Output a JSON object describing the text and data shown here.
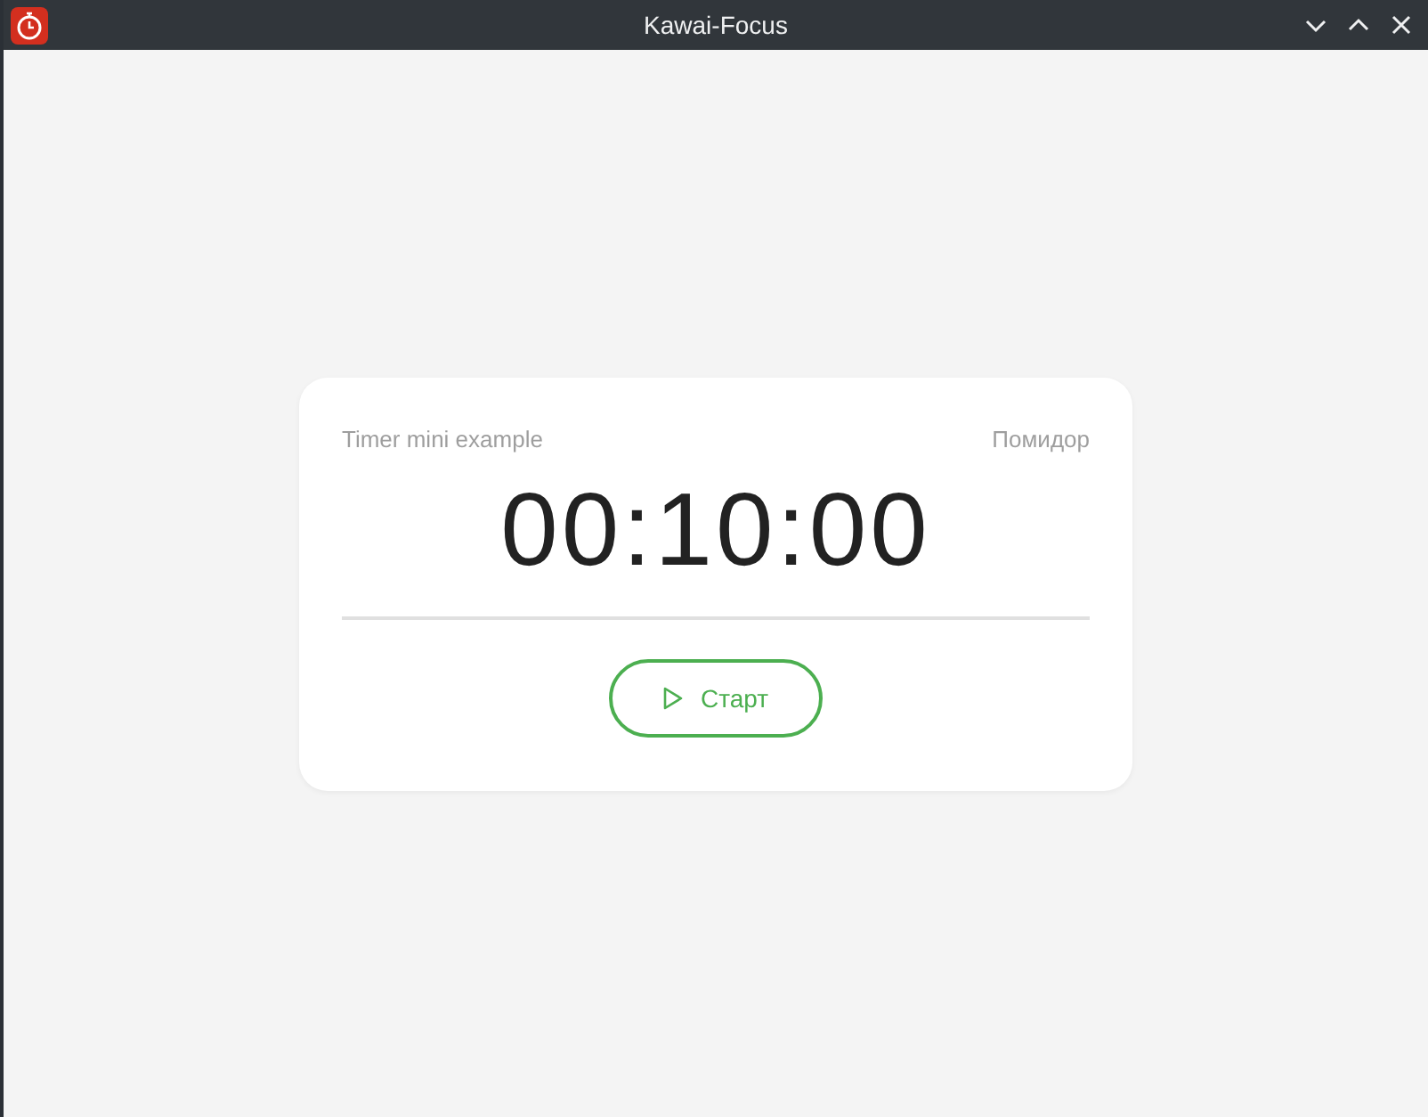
{
  "window": {
    "title": "Kawai-Focus"
  },
  "timer": {
    "name": "Timer mini example",
    "mode": "Помидор",
    "time": "00:10:00",
    "start_button": "Старт"
  }
}
